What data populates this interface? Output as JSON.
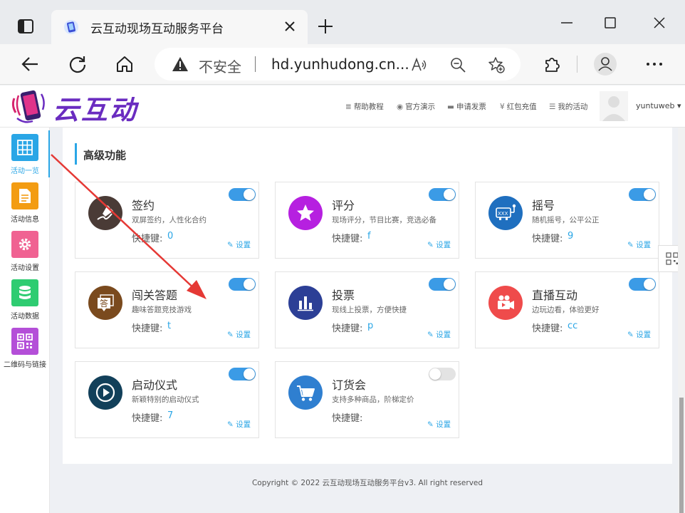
{
  "browser": {
    "tab_title": "云互动现场互动服务平台",
    "security_label": "不安全",
    "url": "hd.yunhudong.cn..."
  },
  "site": {
    "logo_text": "云互动",
    "nav": [
      {
        "icon": "≣",
        "label": "帮助教程"
      },
      {
        "icon": "◉",
        "label": "官方演示"
      },
      {
        "icon": "▬",
        "label": "申请发票"
      },
      {
        "icon": "¥",
        "label": "红包充值"
      },
      {
        "icon": "☰",
        "label": "我的活动"
      }
    ],
    "user_name": "yuntuweb ▾"
  },
  "sidebar": {
    "items": [
      {
        "label": "活动一览",
        "color": "#2aa6e6"
      },
      {
        "label": "活动信息",
        "color": "#f39c12"
      },
      {
        "label": "活动设置",
        "color": "#f06292"
      },
      {
        "label": "活动数据",
        "color": "#2ecc71"
      },
      {
        "label": "二维码与链接",
        "color": "#b44fd8"
      }
    ]
  },
  "main": {
    "section_title": "高级功能",
    "key_label": "快捷键:",
    "settings_label": "设置",
    "cards": [
      {
        "title": "签约",
        "desc": "双屏签约，人性化合约",
        "key": "0",
        "enabled": true,
        "color": "#4a3b36"
      },
      {
        "title": "评分",
        "desc": "现场评分，节目比赛，竞选必备",
        "key": "f",
        "enabled": true,
        "color": "#b620e0"
      },
      {
        "title": "摇号",
        "desc": "随机摇号，公平公正",
        "key": "9",
        "enabled": true,
        "color": "#1f6fbf"
      },
      {
        "title": "闯关答题",
        "desc": "趣味答题竞技游戏",
        "key": "t",
        "enabled": true,
        "color": "#7a4a1e"
      },
      {
        "title": "投票",
        "desc": "现线上投票，方便快捷",
        "key": "p",
        "enabled": true,
        "color": "#2c3f96"
      },
      {
        "title": "直播互动",
        "desc": "边玩边看，体验更好",
        "key": "cc",
        "enabled": true,
        "color": "#ef4b4b"
      },
      {
        "title": "启动仪式",
        "desc": "新颖特别的启动仪式",
        "key": "7",
        "enabled": true,
        "color": "#12405a"
      },
      {
        "title": "订货会",
        "desc": "支持多种商品，阶梯定价",
        "key": "",
        "enabled": false,
        "color": "#2f7fd0"
      }
    ]
  },
  "footer": {
    "copyright": "Copyright © 2022 云互动现场互动服务平台v3. All right reserved"
  }
}
